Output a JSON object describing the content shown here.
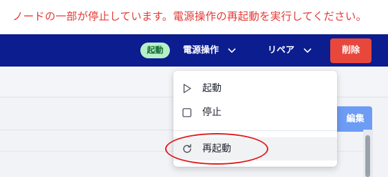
{
  "alert": {
    "message": "ノードの一部が停止しています。電源操作の再起動を実行してください。",
    "color": "#e53935"
  },
  "toolbar": {
    "status_badge": "起動",
    "power_label": "電源操作",
    "repair_label": "リペア",
    "delete_label": "削除",
    "background": "#0b1d8f",
    "delete_color": "#e8473b"
  },
  "content": {
    "edit_label": "編集"
  },
  "power_menu": {
    "items": [
      {
        "label": "起動",
        "icon": "play-icon"
      },
      {
        "label": "停止",
        "icon": "square-icon"
      },
      {
        "label": "再起動",
        "icon": "refresh-icon",
        "highlighted": true
      }
    ]
  },
  "annotation": {
    "target": "再起動",
    "color": "#e11b1b"
  }
}
